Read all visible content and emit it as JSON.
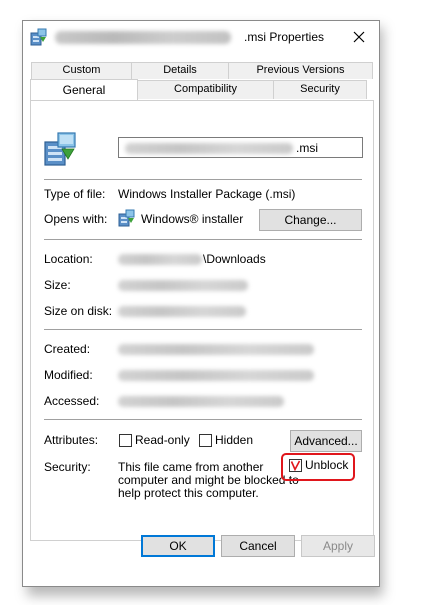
{
  "window": {
    "title_suffix": ".msi Properties"
  },
  "tabs": {
    "row1": [
      "Custom",
      "Details",
      "Previous Versions"
    ],
    "row2": [
      "General",
      "Compatibility",
      "Security"
    ]
  },
  "general": {
    "filename_suffix": ".msi",
    "type_label": "Type of file:",
    "type_value": "Windows Installer Package (.msi)",
    "opens_label": "Opens with:",
    "opens_value": "Windows® installer",
    "change_button": "Change...",
    "location_label": "Location:",
    "location_suffix": "\\Downloads",
    "size_label": "Size:",
    "size_on_disk_label": "Size on disk:",
    "created_label": "Created:",
    "modified_label": "Modified:",
    "accessed_label": "Accessed:",
    "attributes_label": "Attributes:",
    "readonly_label": "Read-only",
    "hidden_label": "Hidden",
    "advanced_button": "Advanced...",
    "security_label": "Security:",
    "security_text_1": "This file came from another",
    "security_text_2": "computer and might be blocked to",
    "security_text_3": "help protect this computer.",
    "unblock_label": "Unblock",
    "unblock_checked": true
  },
  "footer": {
    "ok": "OK",
    "cancel": "Cancel",
    "apply": "Apply"
  },
  "colors": {
    "highlight": "#e0161c",
    "check": "#e0161c",
    "ok_border": "#0078d7"
  }
}
